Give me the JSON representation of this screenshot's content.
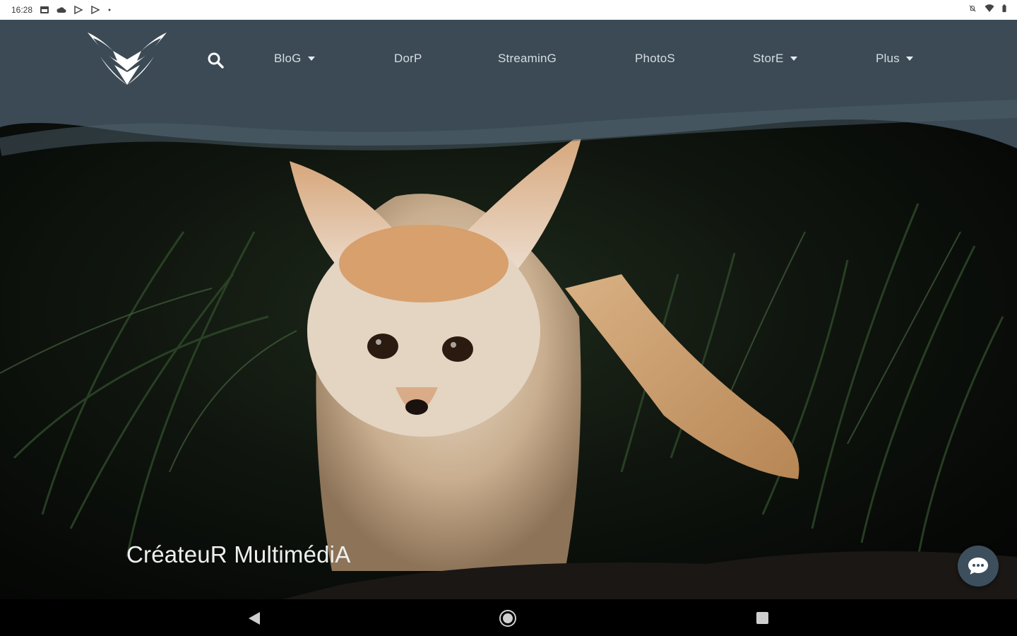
{
  "status_bar": {
    "time": "16:28",
    "left_icons": [
      "calendar-icon",
      "cloud-icon",
      "play-store-icon",
      "play-store-icon",
      "dot-icon"
    ],
    "right_icons": [
      "notifications-off-icon",
      "wifi-icon",
      "battery-icon"
    ]
  },
  "header": {
    "logo": "fennec-fox-logo",
    "search_icon": "search-icon",
    "nav": [
      {
        "label": "BloG",
        "dropdown": true
      },
      {
        "label": "DorP",
        "dropdown": false
      },
      {
        "label": "StreaminG",
        "dropdown": false
      },
      {
        "label": "PhotoS",
        "dropdown": false
      },
      {
        "label": "StorE",
        "dropdown": true
      },
      {
        "label": "Plus",
        "dropdown": true
      }
    ],
    "bg_color": "#3b4a55"
  },
  "hero": {
    "title": "CréateuR MultimédiA",
    "image": "fennec fox in grass at night"
  },
  "chat_button": {
    "icon": "chat-bubble-icon",
    "color": "#3d4f5c"
  },
  "android_nav": {
    "back": "back-icon",
    "home": "home-icon",
    "recents": "recents-icon"
  }
}
